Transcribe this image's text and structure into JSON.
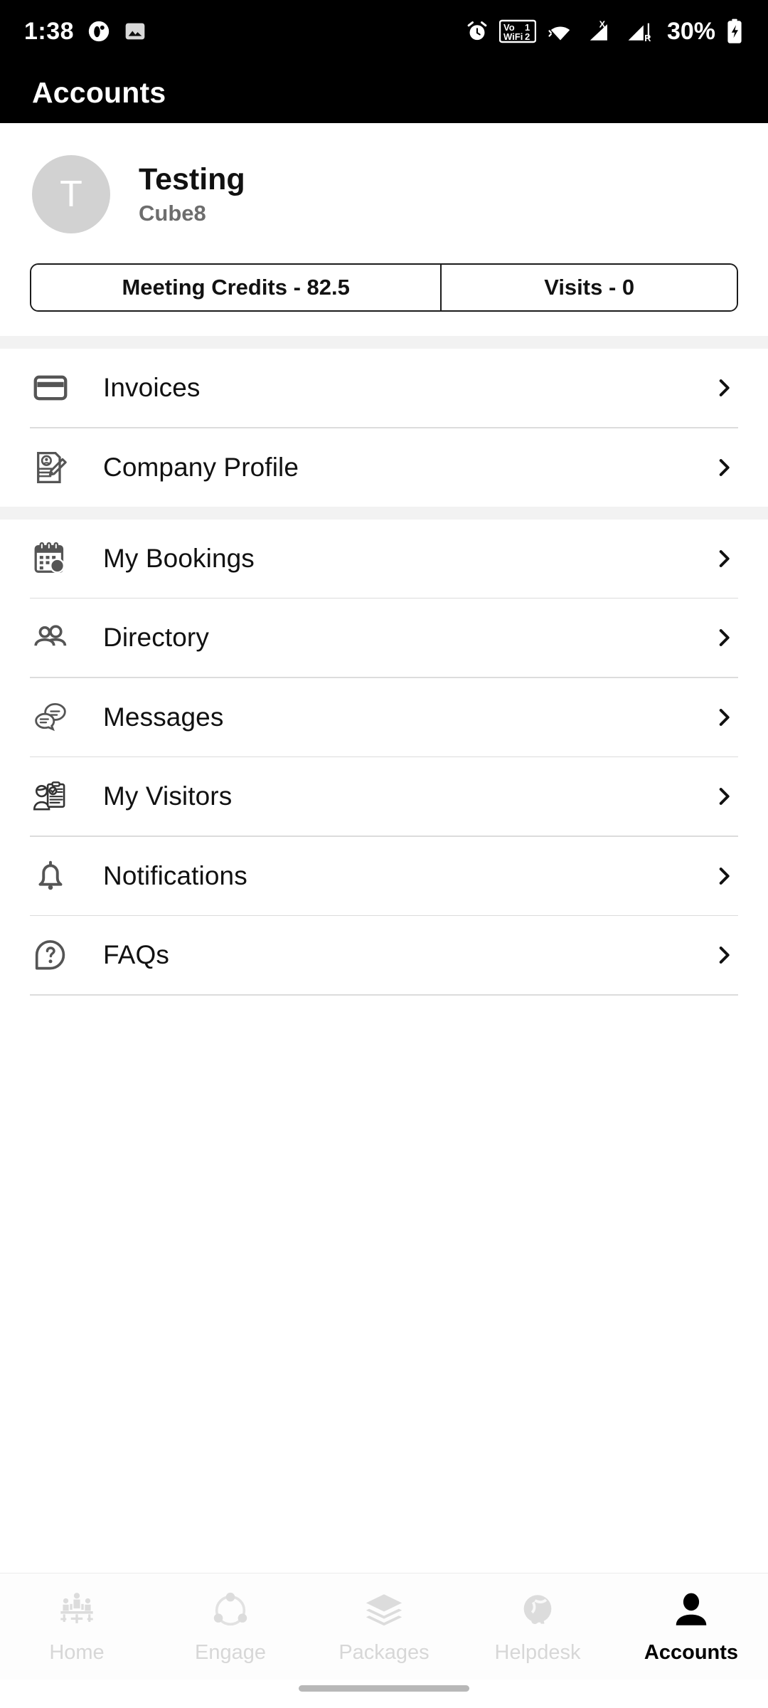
{
  "status_bar": {
    "time": "1:38",
    "battery_percent": "30%",
    "icons": [
      "app-circle-icon",
      "gallery-image-icon",
      "alarm-clock-icon",
      "vowifi-icon",
      "wifi-icon",
      "signal-x-icon",
      "signal-r-icon",
      "battery-charging-icon"
    ],
    "vowifi_label_top": "Vo",
    "vowifi_label_bottom": "WiFi",
    "sim1_label": "1",
    "sim2_label": "2",
    "signal_x_label": "X",
    "signal_r_label": "R"
  },
  "header": {
    "title": "Accounts"
  },
  "profile": {
    "avatar_initial": "T",
    "name": "Testing",
    "company": "Cube8"
  },
  "segmented_control": {
    "options": [
      {
        "label": "Meeting Credits - 82.5",
        "name": "meeting-credits"
      },
      {
        "label": "Visits - 0",
        "name": "visits"
      }
    ]
  },
  "menu_groups": [
    {
      "items": [
        {
          "label": "Invoices",
          "icon": "credit-card-icon"
        },
        {
          "label": "Company Profile",
          "icon": "document-pencil-icon"
        }
      ]
    },
    {
      "items": [
        {
          "label": "My Bookings",
          "icon": "calendar-icon"
        },
        {
          "label": "Directory",
          "icon": "people-group-icon"
        },
        {
          "label": "Messages",
          "icon": "chat-bubbles-icon"
        },
        {
          "label": "My Visitors",
          "icon": "visitor-clipboard-icon"
        },
        {
          "label": "Notifications",
          "icon": "bell-icon"
        },
        {
          "label": "FAQs",
          "icon": "question-bubble-icon"
        }
      ]
    }
  ],
  "bottom_nav": {
    "items": [
      {
        "label": "Home",
        "icon": "meeting-people-icon",
        "active": false
      },
      {
        "label": "Engage",
        "icon": "network-nodes-icon",
        "active": false
      },
      {
        "label": "Packages",
        "icon": "layers-stack-icon",
        "active": false
      },
      {
        "label": "Helpdesk",
        "icon": "headset-support-icon",
        "active": false
      },
      {
        "label": "Accounts",
        "icon": "person-icon",
        "active": true
      }
    ]
  },
  "colors": {
    "header_bg": "#000000",
    "accent_active": "#000000",
    "inactive_nav": "#d7d7d7",
    "divider": "#dcdcdc",
    "group_gap": "#f2f2f2",
    "avatar_bg": "#d2d2d2"
  }
}
